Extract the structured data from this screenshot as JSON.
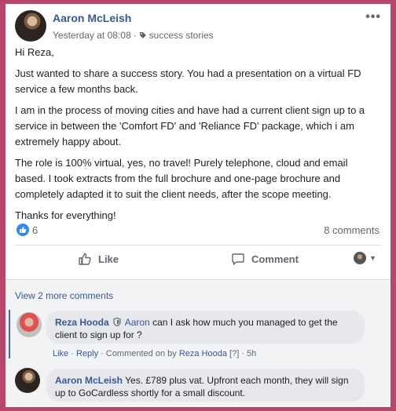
{
  "post": {
    "author": "Aaron McLeish",
    "time": "Yesterday at 08:08",
    "separator": "·",
    "tag": "success stories",
    "paragraphs": [
      "Hi Reza,",
      "Just wanted to share a success story. You had a presentation on a virtual FD service a few months back.",
      "I am in the process of moving cities and have had a current client sign up to a service in between the 'Comfort FD' and 'Reliance FD' package, which i am extremely happy about.",
      "The role is 100% virtual, yes, no travel! Purely telephone, cloud and email based. I took extracts from the full brochure and one-page brochure and completely adapted it to suit the client needs, after the scope meeting.",
      "Thanks for everything!"
    ],
    "more_icon": "•••"
  },
  "stats": {
    "like_count": "6",
    "comment_count": "8 comments"
  },
  "actions": {
    "like_label": "Like",
    "comment_label": "Comment",
    "caret": "▼"
  },
  "comments": {
    "view_more": "View 2 more comments",
    "items": [
      {
        "author": "Reza Hooda",
        "mention": "Aaron",
        "text": " can I ask how much you managed to get the client to sign up for ?",
        "like": "Like",
        "reply": "Reply",
        "sep": " · ",
        "commented_on": "Commented on by ",
        "commented_by": "Reza Hooda",
        "help": " [?] ",
        "time": "5h"
      },
      {
        "author": "Aaron McLeish",
        "text": " Yes. £789 plus vat. Upfront each month, they will sign up to GoCardless shortly for a small discount."
      }
    ]
  },
  "colors": {
    "page_border": "#b7466a",
    "link_blue": "#385898",
    "like_blue": "#2d88ff"
  }
}
